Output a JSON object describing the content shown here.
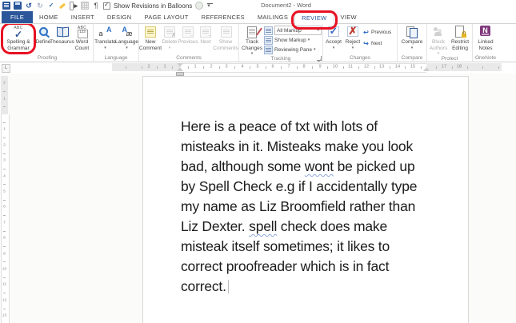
{
  "titlebar": {
    "title": "Document2 - Word",
    "show_revisions_label": "Show Revisions in Balloons"
  },
  "tabs": [
    {
      "label": "FILE",
      "style": "file"
    },
    {
      "label": "HOME",
      "style": ""
    },
    {
      "label": "INSERT",
      "style": ""
    },
    {
      "label": "DESIGN",
      "style": ""
    },
    {
      "label": "PAGE LAYOUT",
      "style": ""
    },
    {
      "label": "REFERENCES",
      "style": ""
    },
    {
      "label": "MAILINGS",
      "style": ""
    },
    {
      "label": "REVIEW",
      "style": "active"
    },
    {
      "label": "VIEW",
      "style": ""
    }
  ],
  "ribbon": {
    "proofing": {
      "label": "Proofing",
      "spelling": "Spelling &\nGrammar",
      "define": "Define",
      "thesaurus": "Thesaurus",
      "word_count": "Word\nCount"
    },
    "language": {
      "label": "Language",
      "translate": "Translate",
      "language": "Language"
    },
    "comments": {
      "label": "Comments",
      "new_comment": "New\nComment",
      "delete": "Delete",
      "previous": "Previous",
      "next": "Next",
      "show_comments": "Show\nComments"
    },
    "tracking": {
      "label": "Tracking",
      "track_changes": "Track\nChanges",
      "all_markup": "All Markup",
      "show_markup": "Show Markup",
      "reviewing_pane": "Reviewing Pane"
    },
    "changes": {
      "label": "Changes",
      "accept": "Accept",
      "reject": "Reject",
      "previous": "Previous",
      "next": "Next"
    },
    "compare": {
      "label": "Compare",
      "compare": "Compare"
    },
    "protect": {
      "label": "Protect",
      "block_authors": "Block\nAuthors",
      "restrict_editing": "Restrict\nEditing"
    },
    "onenote": {
      "label": "OneNote",
      "linked_notes": "Linked\nNotes"
    }
  },
  "ruler": {
    "tab_selector": "L",
    "h_left": [
      "2",
      "1"
    ],
    "h_center": [
      "1",
      "2",
      "3",
      "4",
      "5",
      "6",
      "7",
      "8",
      "9",
      "10",
      "11",
      "12",
      "13",
      "14",
      "15"
    ],
    "h_right": [
      "17",
      "18"
    ],
    "v_top": [
      "2",
      "1"
    ],
    "v_side": [
      "1",
      "2",
      "3",
      "4",
      "5",
      "6",
      "7",
      "8",
      "9",
      "10",
      "11",
      "12",
      "13"
    ]
  },
  "document": {
    "lines": [
      {
        "segs": [
          {
            "t": "Here is a peace of txt with lots of"
          }
        ]
      },
      {
        "segs": [
          {
            "t": "misteaks in it. Misteaks make you look"
          }
        ]
      },
      {
        "segs": [
          {
            "t": "bad, although some "
          },
          {
            "t": "wont",
            "sq": true
          },
          {
            "t": " be picked up"
          }
        ]
      },
      {
        "segs": [
          {
            "t": "by Spell Check e.g if I accidentally type"
          }
        ]
      },
      {
        "segs": [
          {
            "t": "my name as Liz Broomfield rather than"
          }
        ]
      },
      {
        "segs": [
          {
            "t": "Liz Dexter. "
          },
          {
            "t": "spell",
            "sq": true
          },
          {
            "t": " check does make"
          }
        ]
      },
      {
        "segs": [
          {
            "t": "misteak itself sometimes; it likes to"
          }
        ]
      },
      {
        "segs": [
          {
            "t": "correct proofreader which is in fact"
          }
        ]
      },
      {
        "segs": [
          {
            "t": "correct.",
            "cursor": true
          }
        ]
      }
    ]
  },
  "icons": {
    "dropdown": "▾",
    "undo": "↺",
    "redo": "↻",
    "pilcrow": "¶",
    "check": "✓",
    "cross": "✗",
    "prev_arrow": "←",
    "next_arrow": "→",
    "open_arrow": "▸"
  },
  "colors": {
    "accent_blue": "#2b579a",
    "annotation_red": "#e81123",
    "squiggle_blue": "#8fa8dc",
    "onenote_purple": "#80397b"
  }
}
